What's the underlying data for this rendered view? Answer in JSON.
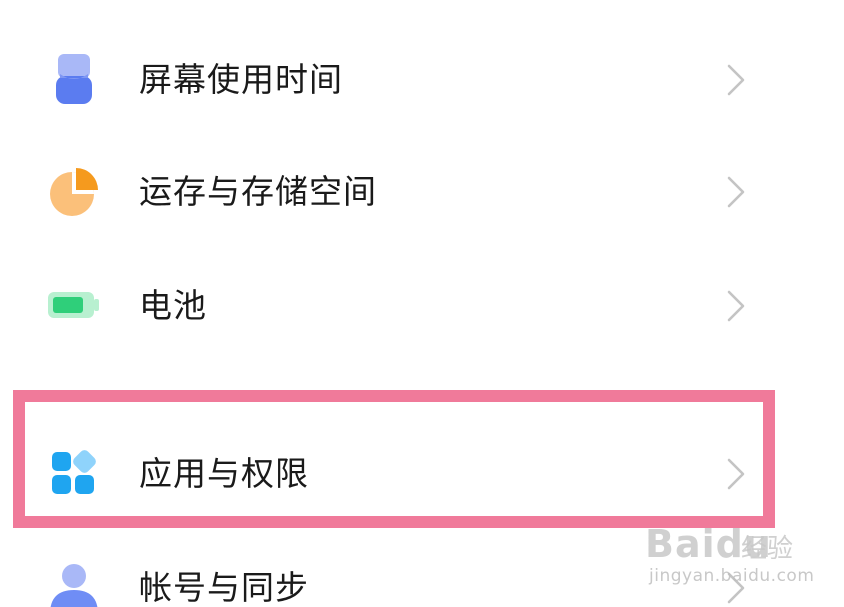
{
  "settings": {
    "items": [
      {
        "label": "屏幕使用时间",
        "icon": "screen-time-icon"
      },
      {
        "label": "运存与存储空间",
        "icon": "storage-pie-icon"
      },
      {
        "label": "电池",
        "icon": "battery-icon"
      },
      {
        "label": "应用与权限",
        "icon": "apps-grid-icon"
      },
      {
        "label": "帐号与同步",
        "icon": "account-person-icon"
      }
    ]
  },
  "watermark": {
    "main": "Baidu",
    "cn": "经验",
    "sub": "jingyan.baidu.com"
  },
  "colors": {
    "highlight_border": "#f07a9a",
    "screen_time_blue": "#5b7cf0",
    "storage_orange": "#f7a94a",
    "battery_green": "#2fcf7a",
    "apps_blue": "#1fa5f0",
    "account_blue": "#6f8df5"
  }
}
